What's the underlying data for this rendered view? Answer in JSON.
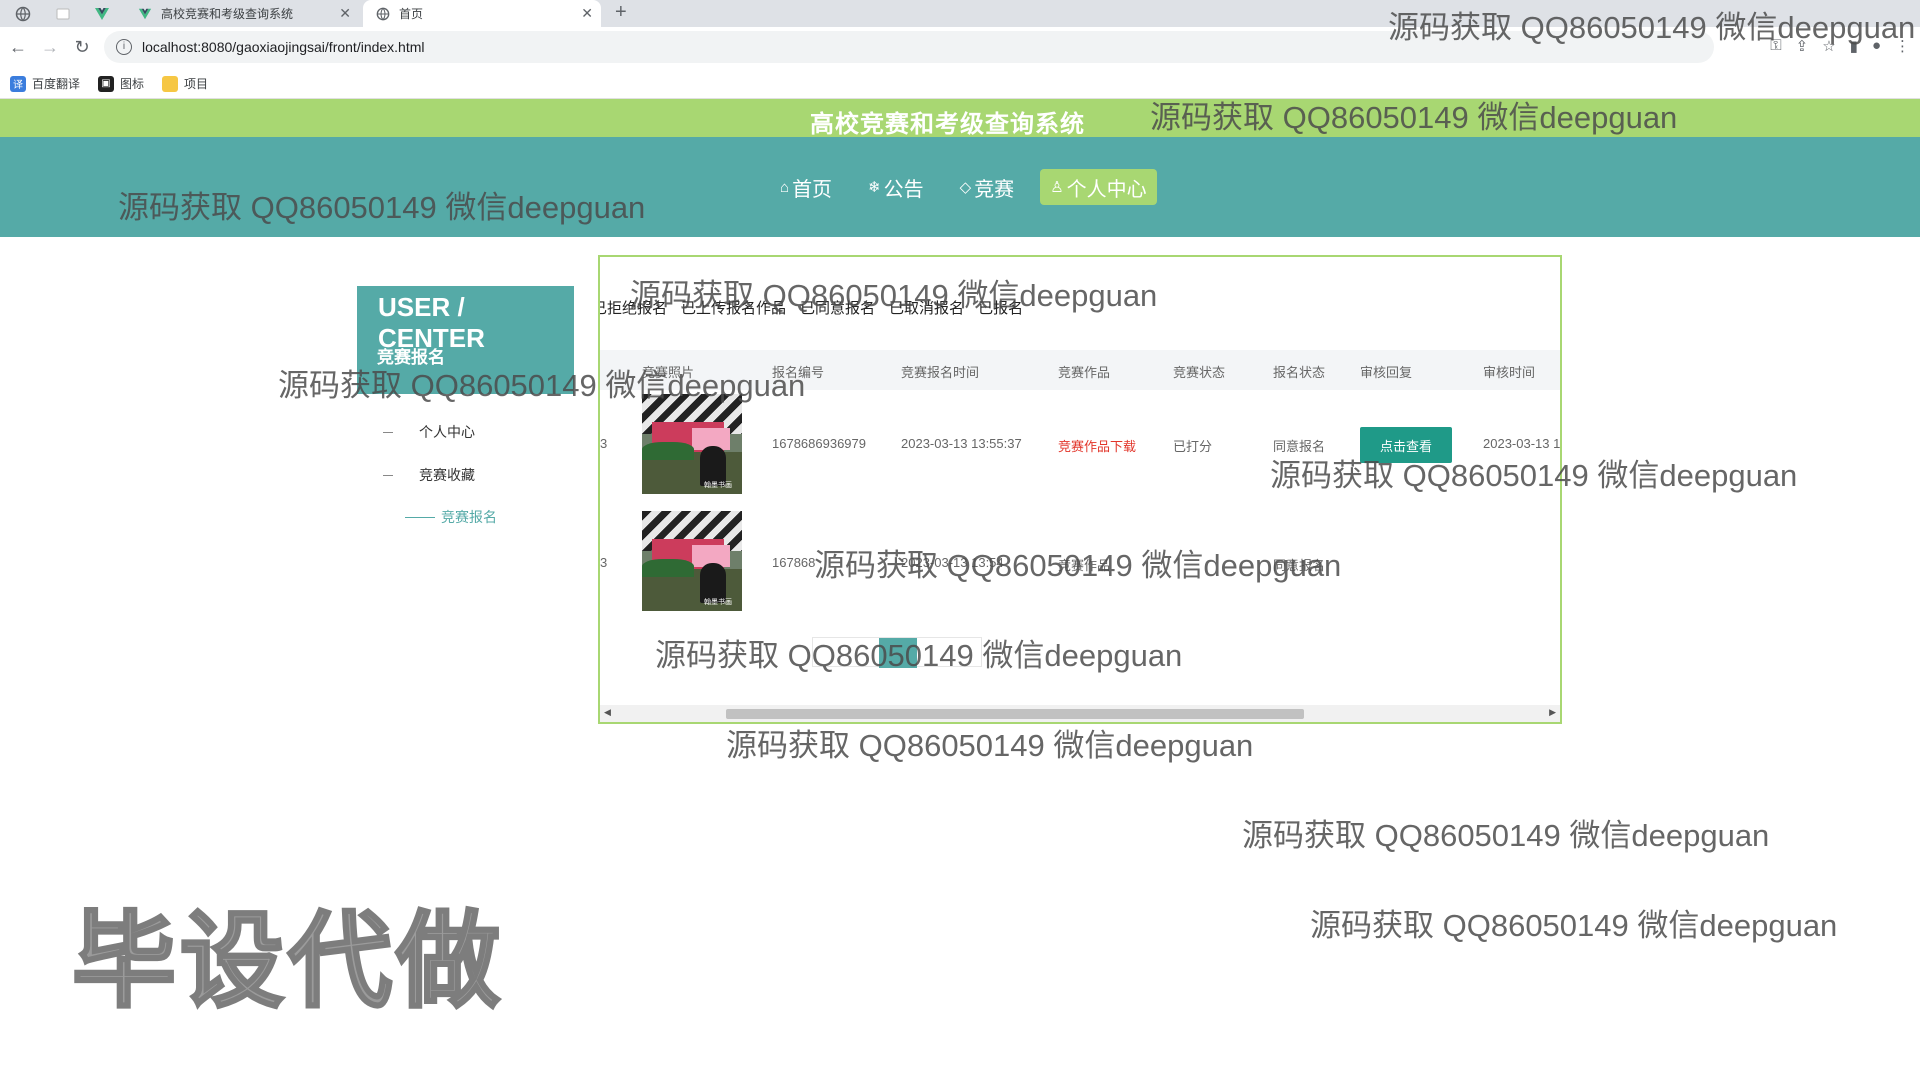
{
  "browser": {
    "tabs": [
      {
        "label": "高校竞赛和考级查询系统",
        "active": false
      },
      {
        "label": "首页",
        "active": true
      }
    ],
    "url": "localhost:8080/gaoxiaojingsai/front/index.html",
    "bookmarks": [
      "百度翻译",
      "图标",
      "项目"
    ]
  },
  "site": {
    "title": "高校竞赛和考级查询系统",
    "nav": [
      {
        "label": "首页",
        "icon": "home-icon",
        "active": false
      },
      {
        "label": "公告",
        "icon": "snowflake-icon",
        "active": false
      },
      {
        "label": "竞赛",
        "icon": "tag-icon",
        "active": false
      },
      {
        "label": "个人中心",
        "icon": "user-icon",
        "active": true
      }
    ]
  },
  "sidebar": {
    "title": "USER / CENTER",
    "subtitle": "竞赛报名",
    "items": [
      "个人中心",
      "竞赛收藏"
    ],
    "sub_item": "竞赛报名"
  },
  "main": {
    "status_tabs": [
      "已拒绝报名",
      "已上传报名作品",
      "已同意报名",
      "已取消报名",
      "已报名"
    ],
    "columns": [
      "竞赛照片",
      "报名编号",
      "竞赛报名时间",
      "竞赛作品",
      "竞赛状态",
      "报名状态",
      "审核回复",
      "审核时间"
    ],
    "rows": [
      {
        "lead": "3",
        "photo_caption": "翰墨书画",
        "number": "1678686936979",
        "time": "2023-03-13 13:55:37",
        "work": "竞赛作品下载",
        "comp_status": "已打分",
        "reg_status": "同意报名",
        "reply_button": "点击查看",
        "review_time": "2023-03-13 1"
      },
      {
        "lead": "3",
        "photo_caption": "翰墨书画",
        "number": "167868",
        "time": "2023-03-13 13:54",
        "work": "竞赛作品",
        "comp_status": "",
        "reg_status": "同意报名"
      }
    ]
  },
  "watermarks": [
    "源码获取 QQ86050149 微信deepguan",
    "源码获取 QQ86050149 微信deepguan",
    "源码获取 QQ86050149 微信deepguan",
    "源码获取 QQ86050149 微信deepguan",
    "源码获取 QQ86050149 微信deepguan",
    "源码获取 QQ86050149 微信deepguan",
    "源码获取 QQ86050149 微信deepguan",
    "源码获取 QQ86050149 微信deepguan",
    "源码获取 QQ86050149 微信deepguan",
    "源码获取 QQ86050149 微信deepguan",
    "源码获取 QQ86050149 微信deepguan"
  ],
  "stamp": "毕设代做"
}
